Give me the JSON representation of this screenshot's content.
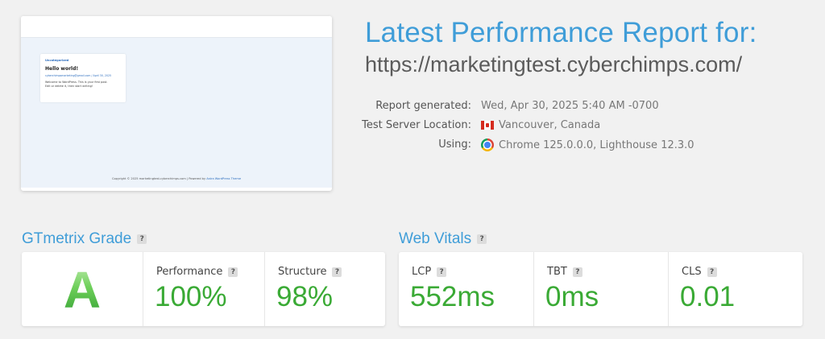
{
  "thumbnail": {
    "category": "Uncategorized",
    "post_title": "Hello world!",
    "post_meta": "cyberchimpsmarketing@gmail.com / April 30, 2025",
    "post_excerpt": "Welcome to WordPress. This is your first post. Edit or delete it, then start writing!",
    "footer_text": "Copyright © 2025 marketingtest.cyberchimps.com | Powered by",
    "footer_link": "Astra WordPress Theme"
  },
  "header": {
    "title": "Latest Performance Report for:",
    "url": "https://marketingtest.cyberchimps.com/"
  },
  "report_info": {
    "generated_label": "Report generated:",
    "generated_value": "Wed, Apr 30, 2025 5:40 AM -0700",
    "location_label": "Test Server Location:",
    "location_value": "Vancouver, Canada",
    "location_icon": "canada-flag-icon",
    "using_label": "Using:",
    "using_value": "Chrome 125.0.0.0, Lighthouse 12.3.0",
    "using_icon": "chrome-icon"
  },
  "gtmetrix": {
    "title": "GTmetrix Grade",
    "help": "?",
    "grade": "A",
    "performance_label": "Performance",
    "performance_value": "100%",
    "structure_label": "Structure",
    "structure_value": "98%"
  },
  "web_vitals": {
    "title": "Web Vitals",
    "help": "?",
    "lcp_label": "LCP",
    "lcp_value": "552ms",
    "tbt_label": "TBT",
    "tbt_value": "0ms",
    "cls_label": "CLS",
    "cls_value": "0.01"
  },
  "colors": {
    "accent_blue": "#3f9dd8",
    "good_green": "#3aaa35"
  }
}
